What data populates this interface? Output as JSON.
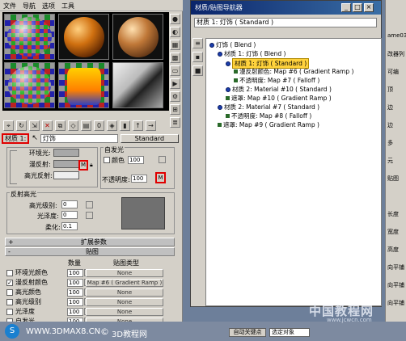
{
  "menu": [
    "文件",
    "导航",
    "选项",
    "工具"
  ],
  "toolbar": {
    "material_name": "材质 1:",
    "material_value": "灯饰",
    "type_button": "Standard"
  },
  "self_illum": {
    "title": "自发光",
    "color_label": "颜色",
    "color_value": "100",
    "opacity_label": "不透明度:",
    "opacity_value": "100",
    "opacity_btn": "M"
  },
  "colors": {
    "ambient": "环境光:",
    "diffuse": "漫反射:",
    "specular": "高光反射:",
    "diffuse_btn": "M"
  },
  "reflection": {
    "title": "反射高光",
    "level_label": "高光级别:",
    "level_value": "0",
    "gloss_label": "光泽度:",
    "gloss_value": "0",
    "soften_label": "柔化:",
    "soften_value": "0.1"
  },
  "rollouts": {
    "extended": "扩展参数",
    "maps": "贴图"
  },
  "maps": {
    "col_amount": "数量",
    "col_type": "贴图类型",
    "rows": [
      {
        "label": "环境光颜色",
        "amount": "100",
        "map": "None",
        "checked": false
      },
      {
        "label": "漫反射颜色",
        "amount": "100",
        "map": "Map #6 ( Gradient Ramp )",
        "checked": true
      },
      {
        "label": "高光颜色",
        "amount": "100",
        "map": "None",
        "checked": false
      },
      {
        "label": "高光级别",
        "amount": "100",
        "map": "None",
        "checked": false
      },
      {
        "label": "光泽度",
        "amount": "100",
        "map": "None",
        "checked": false
      },
      {
        "label": "自发光",
        "amount": "100",
        "map": "None",
        "checked": false
      }
    ]
  },
  "navigator": {
    "title": "材质/贴图导航器",
    "header": "材质 1: 灯饰 ( Standard )",
    "tree": [
      {
        "text": "灯饰 ( Blend )",
        "indent": 0,
        "kind": "dot"
      },
      {
        "text": "材质 1: 灯饰 ( Blend )",
        "indent": 1,
        "kind": "dot"
      },
      {
        "text": "材质 1: 灯饰 ( Standard )",
        "indent": 2,
        "kind": "dot",
        "highlight": true
      },
      {
        "text": "漫反射颜色: Map #6 ( Gradient Ramp )",
        "indent": 3,
        "kind": "sq"
      },
      {
        "text": "不透明度: Map #7 ( Falloff )",
        "indent": 3,
        "kind": "sq"
      },
      {
        "text": "材质 2: Material #10 ( Standard )",
        "indent": 2,
        "kind": "dot"
      },
      {
        "text": "遮罩: Map #10 ( Gradient Ramp )",
        "indent": 2,
        "kind": "sq"
      },
      {
        "text": "材质 2: Material #7 ( Standard )",
        "indent": 1,
        "kind": "dot"
      },
      {
        "text": "不透明度: Map #8 ( Falloff )",
        "indent": 2,
        "kind": "sq"
      },
      {
        "text": "遮罩: Map #9 ( Gradient Ramp )",
        "indent": 1,
        "kind": "sq"
      }
    ]
  },
  "right_panel": [
    "ame03",
    "改器列",
    "可编",
    "顶",
    "边",
    "边",
    "多",
    "元",
    "贴图",
    "",
    "长度",
    "宽度",
    "高度",
    "向平铺",
    "向平铺",
    "向平铺"
  ],
  "watermark": {
    "site": "WWW.3DMAX8.CN",
    "brand": "3D教程网",
    "cn": "中国教程网",
    "url": "www.jcwcn.com"
  },
  "status": {
    "text1": "自动关键点",
    "text2": "选定对象"
  }
}
